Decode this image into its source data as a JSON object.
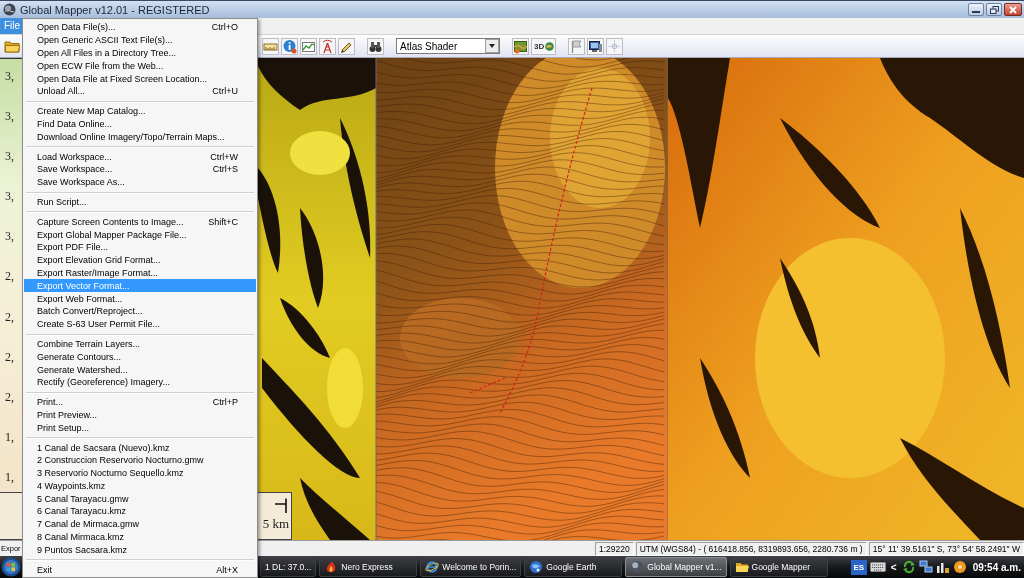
{
  "window": {
    "title": "Global Mapper v12.01 - REGISTERED"
  },
  "menu_bar": [
    {
      "label": "File",
      "selected": true
    }
  ],
  "toolbar": {
    "shader_dropdown": "Atlas Shader",
    "view_3d_label": "3D"
  },
  "map": {
    "legend_labels": [
      "3,",
      "3,",
      "3,",
      "3,",
      "3,",
      "2,",
      "2,",
      "2,",
      "2,",
      "1,",
      "1,"
    ],
    "scale_label": "5 km"
  },
  "file_menu": {
    "groups": [
      [
        {
          "label": "Open Data File(s)...",
          "shortcut": "Ctrl+O",
          "selected": false
        },
        {
          "label": "Open Generic ASCII Text File(s)...",
          "selected": false
        },
        {
          "label": "Open All Files in a Directory Tree...",
          "selected": false
        },
        {
          "label": "Open ECW File from the Web...",
          "selected": false
        },
        {
          "label": "Open Data File at Fixed Screen Location...",
          "selected": false
        },
        {
          "label": "Unload All...",
          "shortcut": "Ctrl+U",
          "selected": false
        }
      ],
      [
        {
          "label": "Create New Map Catalog...",
          "selected": false
        },
        {
          "label": "Find Data Online...",
          "selected": false
        },
        {
          "label": "Download Online Imagery/Topo/Terrain Maps...",
          "selected": false
        }
      ],
      [
        {
          "label": "Load Workspace...",
          "shortcut": "Ctrl+W",
          "selected": false
        },
        {
          "label": "Save Workspace...",
          "shortcut": "Ctrl+S",
          "selected": false
        },
        {
          "label": "Save Workspace As...",
          "selected": false
        }
      ],
      [
        {
          "label": "Run Script...",
          "selected": false
        }
      ],
      [
        {
          "label": "Capture Screen Contents to Image...",
          "shortcut": "Shift+C",
          "selected": false
        },
        {
          "label": "Export Global Mapper Package File...",
          "selected": false
        },
        {
          "label": "Export PDF File...",
          "selected": false
        },
        {
          "label": "Export Elevation Grid Format...",
          "selected": false
        },
        {
          "label": "Export Raster/Image Format...",
          "selected": false
        },
        {
          "label": "Export Vector Format...",
          "selected": true
        },
        {
          "label": "Export Web Format...",
          "selected": false
        },
        {
          "label": "Batch Convert/Reproject...",
          "selected": false
        },
        {
          "label": "Create S-63 User Permit File...",
          "selected": false
        }
      ],
      [
        {
          "label": "Combine Terrain Layers...",
          "selected": false
        },
        {
          "label": "Generate Contours...",
          "selected": false
        },
        {
          "label": "Generate Watershed...",
          "selected": false
        },
        {
          "label": "Rectify (Georeference) Imagery...",
          "selected": false
        }
      ],
      [
        {
          "label": "Print...",
          "shortcut": "Ctrl+P",
          "selected": false
        },
        {
          "label": "Print Preview...",
          "selected": false
        },
        {
          "label": "Print Setup...",
          "selected": false
        }
      ],
      [
        {
          "label": "1 Canal de Sacsara (Nuevo).kmz",
          "selected": false
        },
        {
          "label": "2 Construccion Reservorio Nocturno.gmw",
          "selected": false
        },
        {
          "label": "3 Reservorio Nocturno Sequello.kmz",
          "selected": false
        },
        {
          "label": "4 Waypoints.kmz",
          "selected": false
        },
        {
          "label": "5 Canal Tarayacu.gmw",
          "selected": false
        },
        {
          "label": "6 Canal Tarayacu.kmz",
          "selected": false
        },
        {
          "label": "7 Canal de Mirmaca.gmw",
          "selected": false
        },
        {
          "label": "8 Canal Mirmaca.kmz",
          "selected": false
        },
        {
          "label": "9 Puntos Sacsara.kmz",
          "selected": false
        }
      ],
      [
        {
          "label": "Exit",
          "shortcut": "Alt+X",
          "selected": false
        }
      ]
    ]
  },
  "status_bar": {
    "message": "Expor",
    "scale": "1:29220",
    "projected": "UTM (WGS84) - ( 616418.856, 8319893.656, 2280.736 m )",
    "geographic": "15° 11' 39.5161\" S, 73° 54' 58.2491\" W"
  },
  "taskbar": {
    "buttons": [
      {
        "label": "1 DL: 37.0...",
        "selected": false
      },
      {
        "label": "Nero Express",
        "selected": false
      },
      {
        "label": "Welcome to Porin...",
        "selected": false
      },
      {
        "label": "Google Earth",
        "selected": false
      },
      {
        "label": "Global Mapper v1...",
        "selected": true
      },
      {
        "label": "Google Mapper",
        "selected": false
      }
    ],
    "language": "ES",
    "chevron": "<",
    "clock": "09:54 a.m."
  }
}
